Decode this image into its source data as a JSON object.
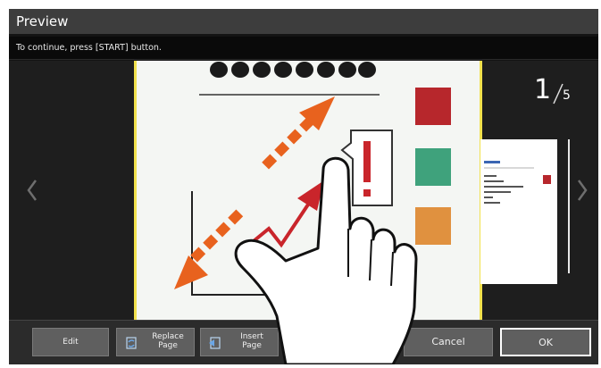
{
  "window": {
    "title": "Preview"
  },
  "message": "To continue, press [START] button.",
  "pager": {
    "current": "1",
    "total": "5"
  },
  "toolbar": {
    "edit_label": "Edit",
    "replace_label_line1": "Replace",
    "replace_label_line2": "Page",
    "insert_label_line1": "Insert",
    "insert_label_line2": "Page",
    "cancel_label": "Cancel",
    "ok_label": "OK"
  },
  "colors": {
    "accent_orange": "#e8621e",
    "page_border_yellow": "#f1e14d",
    "red_block": "#b7272c",
    "green_block": "#3fa27c",
    "orange_block": "#e0913f"
  }
}
